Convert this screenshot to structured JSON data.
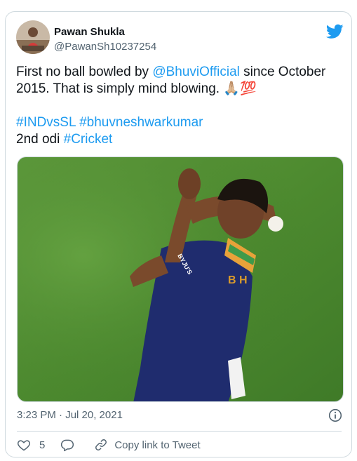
{
  "tweet": {
    "author_name": "Pawan Shukla",
    "author_handle": "@PawanSh10237254",
    "logo_icon": "twitter-bird-icon",
    "text": {
      "line1_a": "First no ball bowled by ",
      "mention": "@BhuviOfficial",
      "line1_b": " since October 2015. That is simply mind blowing. ",
      "emoji": "🙏🏼💯",
      "hashtag1": "#INDvsSL",
      "hashtag2": "#bhuvneshwarkumar",
      "line3_a": "2nd odi ",
      "hashtag3": "#Cricket"
    },
    "timestamp": "3:23 PM · Jul 20, 2021",
    "actions": {
      "like_count": "5",
      "copy_link_label": "Copy link to Tweet"
    },
    "colors": {
      "link": "#1d9bf0",
      "secondary_text": "#536471",
      "border": "#cfd9de"
    }
  }
}
